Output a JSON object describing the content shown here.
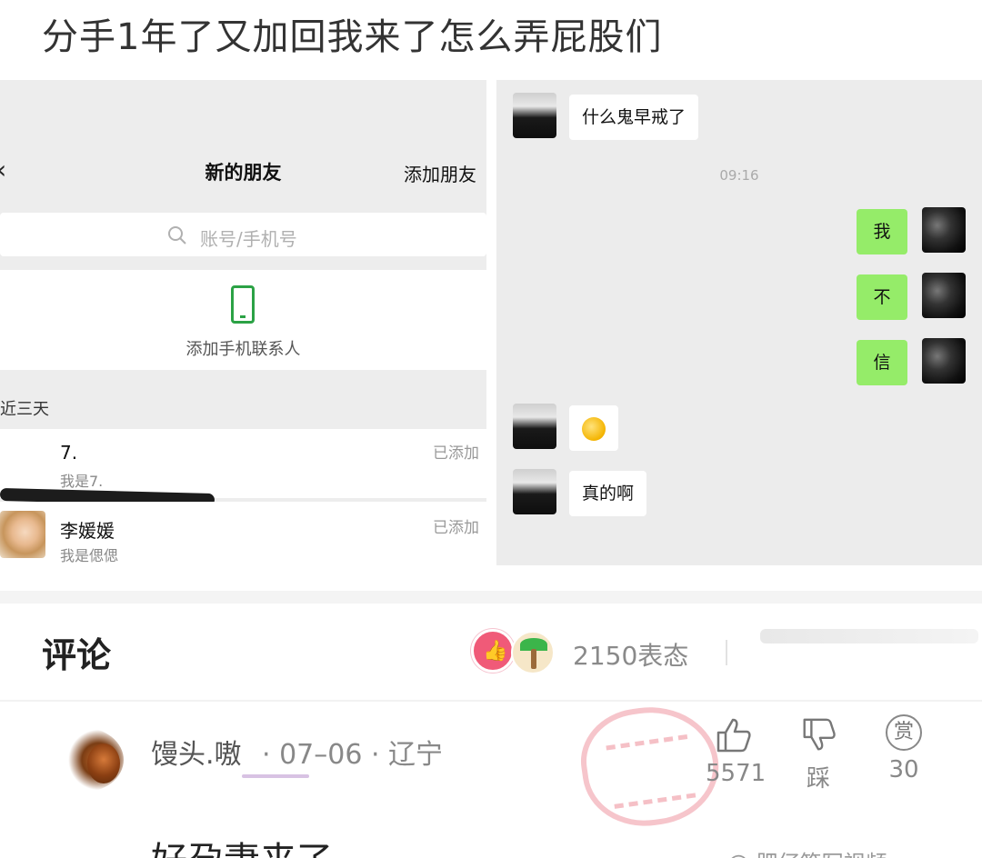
{
  "post": {
    "title": "分手1年了又加回我来了怎么弄屁股们"
  },
  "new_friends": {
    "title": "新的朋友",
    "add_friend_label": "添加朋友",
    "search_placeholder": "账号/手机号",
    "add_mobile_contacts_label": "添加手机联系人",
    "section_label": "近三天",
    "items": [
      {
        "name": "7.",
        "note": "我是7.",
        "status": "已添加"
      },
      {
        "name": "李媛媛",
        "note": "我是偲偲",
        "status": "已添加"
      }
    ]
  },
  "chat": {
    "timestamp": "09:16",
    "messages": [
      {
        "side": "them",
        "text": "什么鬼早戒了"
      },
      {
        "side": "me",
        "text": "我"
      },
      {
        "side": "me",
        "text": "不"
      },
      {
        "side": "me",
        "text": "信"
      },
      {
        "side": "them",
        "text": "",
        "icon": "laughing-emoji"
      },
      {
        "side": "them",
        "text": "真的啊"
      }
    ]
  },
  "comments": {
    "heading": "评论",
    "reaction_count": "2150表态",
    "items": [
      {
        "author": "馒头.嗷",
        "meta": "· 07–06 · 辽宁",
        "like_count": "5571",
        "dislike_label": "踩",
        "reward_icon_label": "赏",
        "reward_count": "30",
        "text": "好孕妻来了"
      }
    ]
  },
  "watermark_text": "@ 肥仔笔写视频"
}
